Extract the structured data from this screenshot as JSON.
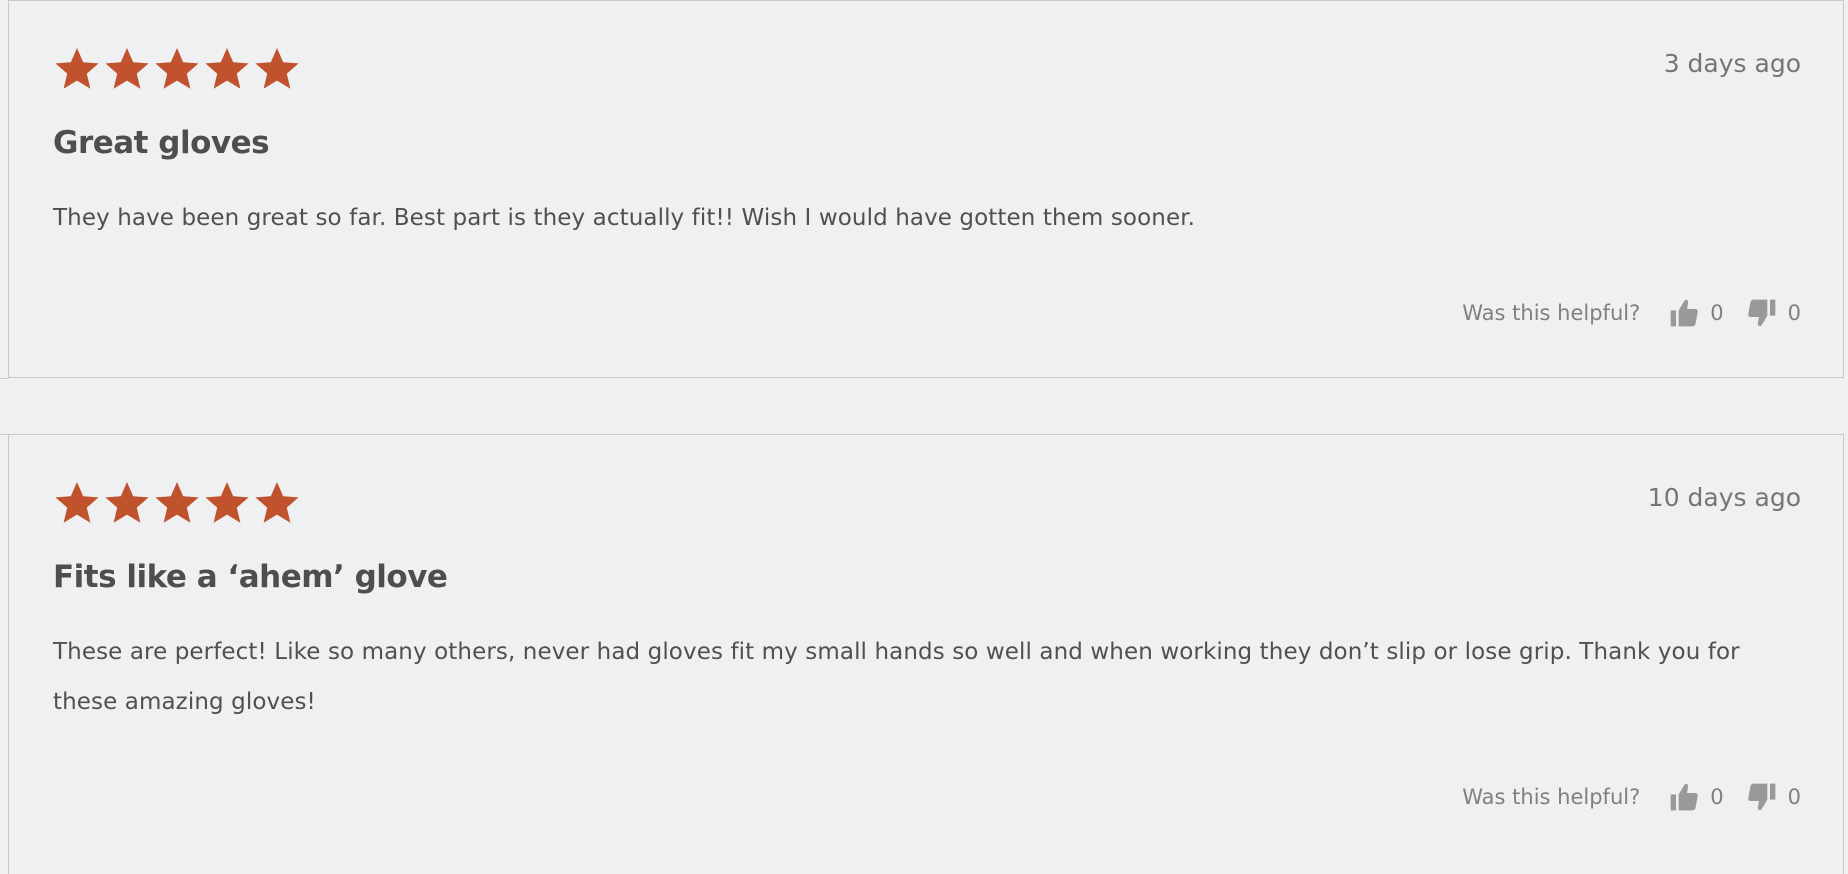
{
  "colors": {
    "star": "#c0532d",
    "thumb": "#999999"
  },
  "reviews": [
    {
      "rating": 5,
      "rating_max": 5,
      "date": "3 days ago",
      "title": "Great gloves",
      "body": "They have been great so far. Best part is they actually fit!! Wish I would have gotten them sooner.",
      "helpful_label": "Was this helpful?",
      "helpful_yes": "0",
      "helpful_no": "0"
    },
    {
      "rating": 5,
      "rating_max": 5,
      "date": "10 days ago",
      "title": "Fits like a ‘ahem’ glove",
      "body": "These are perfect! Like so many others, never had gloves fit my small hands so well and when working they don’t slip or lose grip. Thank you for these amazing gloves!",
      "helpful_label": "Was this helpful?",
      "helpful_yes": "0",
      "helpful_no": "0"
    }
  ]
}
